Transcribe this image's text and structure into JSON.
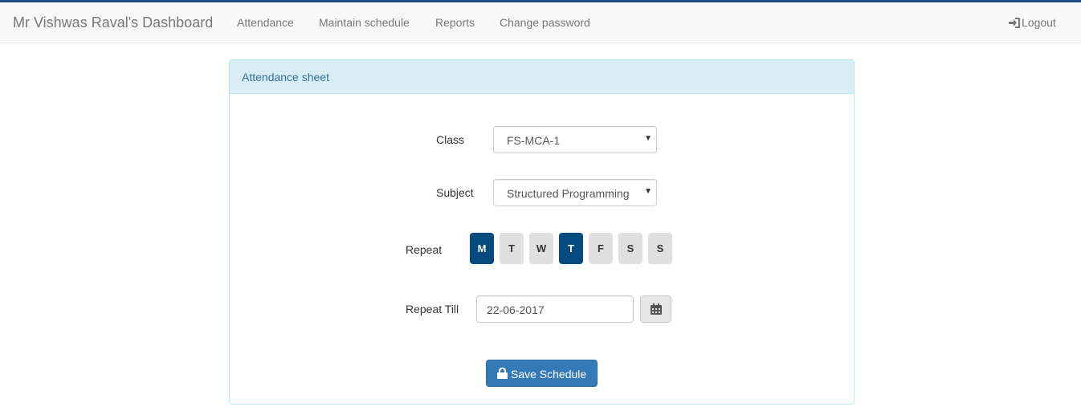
{
  "navbar": {
    "brand": "Mr Vishwas Raval's Dashboard",
    "items": [
      {
        "label": "Attendance"
      },
      {
        "label": "Maintain schedule"
      },
      {
        "label": "Reports"
      },
      {
        "label": "Change password"
      }
    ],
    "logout_label": "Logout",
    "logout_icon": "log-in-icon"
  },
  "panel": {
    "title": "Attendance sheet"
  },
  "form": {
    "class_label": "Class",
    "class_value": "FS-MCA-1",
    "subject_label": "Subject",
    "subject_value": "Structured Programming",
    "repeat_label": "Repeat",
    "days": [
      {
        "label": "M",
        "selected": true
      },
      {
        "label": "T",
        "selected": false
      },
      {
        "label": "W",
        "selected": false
      },
      {
        "label": "T",
        "selected": true
      },
      {
        "label": "F",
        "selected": false
      },
      {
        "label": "S",
        "selected": false
      },
      {
        "label": "S",
        "selected": false
      }
    ],
    "repeat_till_label": "Repeat Till",
    "repeat_till_value": "22-06-2017",
    "calendar_icon": "calendar-icon",
    "save_label": "Save Schedule",
    "save_icon": "lock-icon"
  },
  "colors": {
    "accent": "#054a7f",
    "primary_button": "#337ab7",
    "panel_heading_bg": "#d9edf7",
    "panel_title": "#31708f",
    "top_border": "#1f4e86"
  }
}
